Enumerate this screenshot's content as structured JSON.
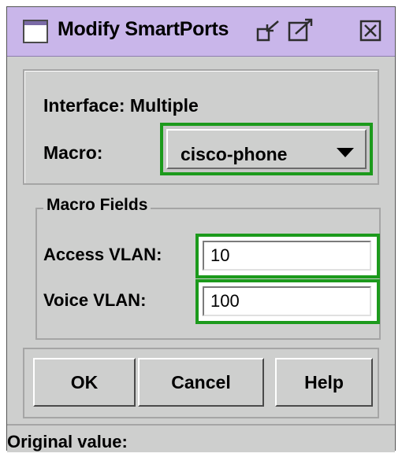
{
  "window": {
    "title": "Modify SmartPorts"
  },
  "form": {
    "interface_text": "Interface: Multiple",
    "macro_label": "Macro:",
    "macro_value": "cisco-phone"
  },
  "macro_fields": {
    "legend": "Macro Fields",
    "access_vlan_label": "Access VLAN:",
    "access_vlan_value": "10",
    "voice_vlan_label": "Voice VLAN:",
    "voice_vlan_value": "100"
  },
  "buttons": {
    "ok": "OK",
    "cancel": "Cancel",
    "help": "Help"
  },
  "status": {
    "text": "Original value:"
  },
  "colors": {
    "title_bar": "#c9b6ea",
    "highlight": "#1c9a1c",
    "panel": "#cecfce"
  }
}
